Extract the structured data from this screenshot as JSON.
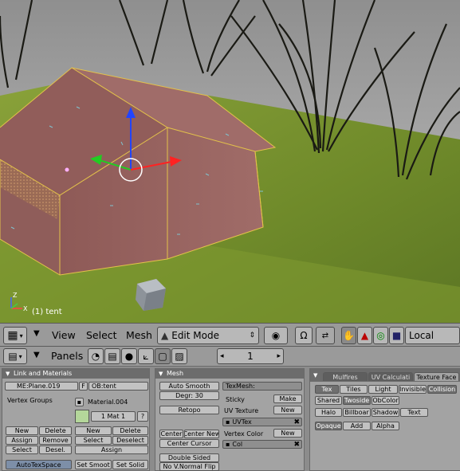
{
  "viewport": {
    "object_label": "(1) tent",
    "axis_x": "X",
    "axis_z": "Z"
  },
  "view_header": {
    "menus": [
      "View",
      "Select",
      "Mesh"
    ],
    "mode": "Edit Mode",
    "orientation": "Local"
  },
  "buttons_header": {
    "panels_label": "Panels",
    "frame": "1"
  },
  "link_materials": {
    "title": "Link and Materials",
    "mesh_name": "ME:Plane.019",
    "f_label": "F",
    "object_name": "OB:tent",
    "vertex_groups_label": "Vertex Groups",
    "material_name": "Material.004",
    "mat_index": "1 Mat 1",
    "question": "?",
    "left_buttons": [
      "New",
      "Delete",
      "Assign",
      "Remove",
      "Select",
      "Desel."
    ],
    "right_buttons": [
      "New",
      "Delete",
      "Select",
      "Deselect",
      "Assign"
    ],
    "autotex": "AutoTexSpace",
    "set_smooth": "Set Smoot",
    "set_solid": "Set Solid"
  },
  "mesh": {
    "title": "Mesh",
    "auto_smooth": "Auto Smooth",
    "degr": "Degr: 30",
    "retopo": "Retopo",
    "center": "Center",
    "center_new": "Center New",
    "center_cursor": "Center Cursor",
    "double_sided": "Double Sided",
    "no_vnormal_flip": "No V.Normal Flip",
    "texmesh": "TexMesh:",
    "sticky": "Sticky",
    "make": "Make",
    "uv_texture_label": "UV Texture",
    "new1": "New",
    "uvtex": "UVTex",
    "vertex_color_label": "Vertex Color",
    "new2": "New",
    "col": "Col"
  },
  "texture_face": {
    "tabs": [
      "Mulfires",
      "UV Calculati",
      "Texture Face"
    ],
    "row1": [
      "Tex",
      "Tiles",
      "Light",
      "Invisible",
      "Collision"
    ],
    "row2": [
      "Shared",
      "Twoside",
      "ObColor"
    ],
    "row3": [
      "Halo",
      "Billboar",
      "Shadow",
      "Text"
    ],
    "row4": [
      "Opaque",
      "Add",
      "Alpha"
    ]
  }
}
